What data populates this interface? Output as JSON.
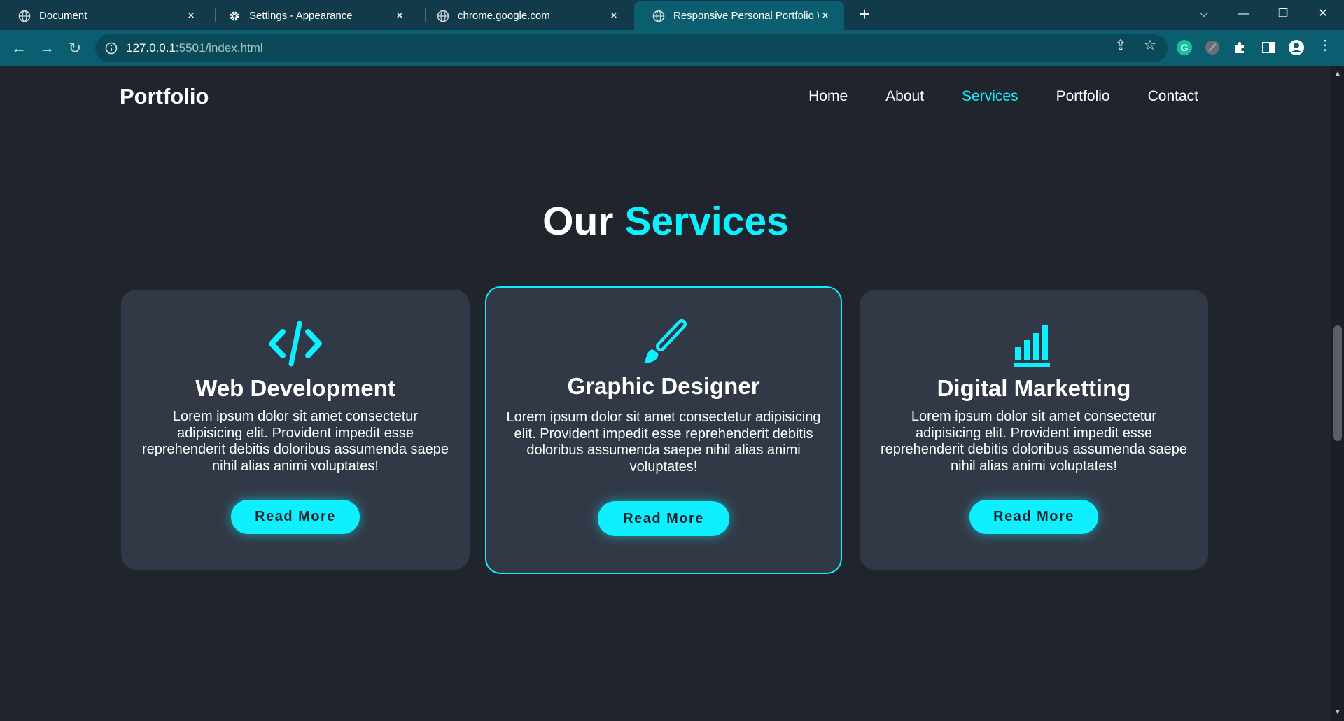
{
  "browser": {
    "tabs": [
      {
        "title": "Document",
        "icon": "globe-icon"
      },
      {
        "title": "Settings - Appearance",
        "icon": "gear-icon"
      },
      {
        "title": "chrome.google.com",
        "icon": "globe-icon"
      },
      {
        "title": "Responsive Personal Portfolio W",
        "icon": "globe-icon",
        "active": true
      }
    ],
    "new_tab": "+",
    "url": {
      "host": "127.0.0.1",
      "rest": ":5501/index.html"
    }
  },
  "site": {
    "logo": "Portfolio",
    "nav": [
      "Home",
      "About",
      "Services",
      "Portfolio",
      "Contact"
    ],
    "active_nav": "Services"
  },
  "services": {
    "title_prefix": "Our",
    "title_accent": "Services",
    "cards": [
      {
        "icon": "code-icon",
        "title": "Web Development",
        "text": "Lorem ipsum dolor sit amet consectetur adipisicing elit. Provident impedit esse reprehenderit debitis doloribus assumenda saepe nihil alias animi voluptates!",
        "button": "Read More"
      },
      {
        "icon": "brush-icon",
        "title": "Graphic Designer",
        "text": "Lorem ipsum dolor sit amet consectetur adipisicing elit. Provident impedit esse reprehenderit debitis doloribus assumenda saepe nihil alias animi voluptates!",
        "button": "Read More"
      },
      {
        "icon": "chart-bar-icon",
        "title": "Digital Marketting",
        "text": "Lorem ipsum dolor sit amet consectetur adipisicing elit. Provident impedit esse reprehenderit debitis doloribus assumenda saepe nihil alias animi voluptates!",
        "button": "Read More"
      }
    ]
  },
  "colors": {
    "accent": "#0ef0ff",
    "background": "#1f242d",
    "card": "#323946",
    "chrome": "#0b5e6f"
  }
}
